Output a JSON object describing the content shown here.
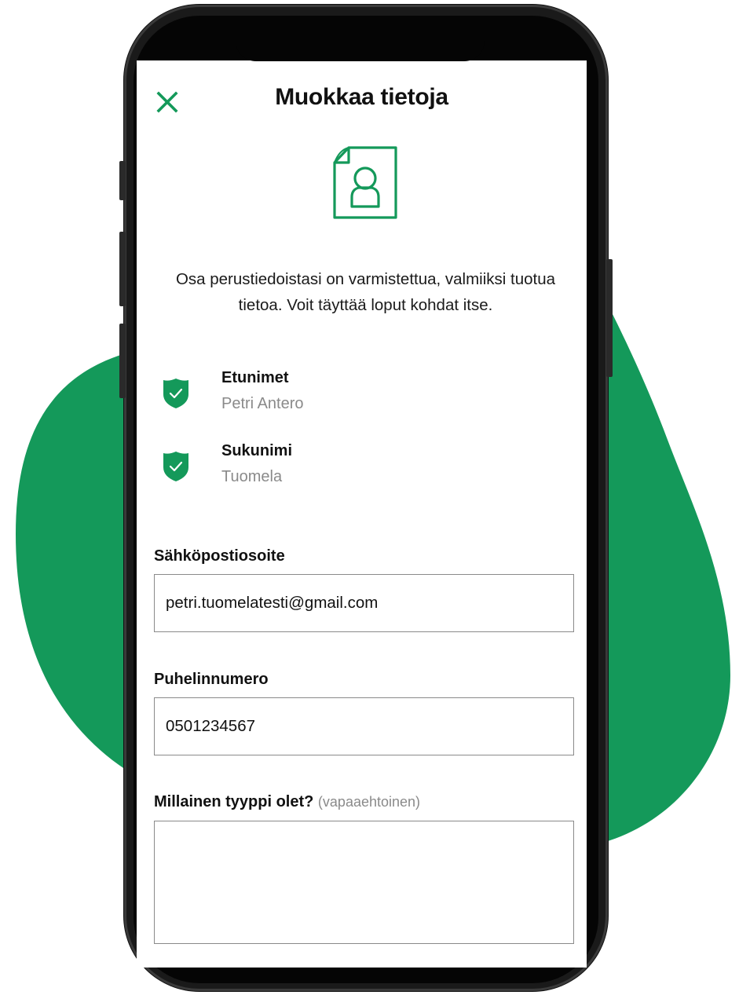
{
  "colors": {
    "accent": "#14995a",
    "phone_body": "#1a1a1a",
    "muted_text": "#8a8a8a"
  },
  "header": {
    "close_icon": "close-x-icon",
    "title": "Muokkaa tietoja"
  },
  "hero_icon": "document-person-icon",
  "intro_text": "Osa perustiedoistasi on varmistettua, valmiiksi tuotua tietoa. Voit täyttää loput kohdat itse.",
  "verified": [
    {
      "icon": "shield-check-icon",
      "label": "Etunimet",
      "value": "Petri Antero"
    },
    {
      "icon": "shield-check-icon",
      "label": "Sukunimi",
      "value": "Tuomela"
    }
  ],
  "form": {
    "email": {
      "label": "Sähköpostiosoite",
      "value": "petri.tuomelatesti@gmail.com"
    },
    "phone": {
      "label": "Puhelinnumero",
      "value": "0501234567"
    },
    "description": {
      "label": "Millainen tyyppi olet?",
      "optional": "(vapaaehtoinen)",
      "value": ""
    }
  }
}
